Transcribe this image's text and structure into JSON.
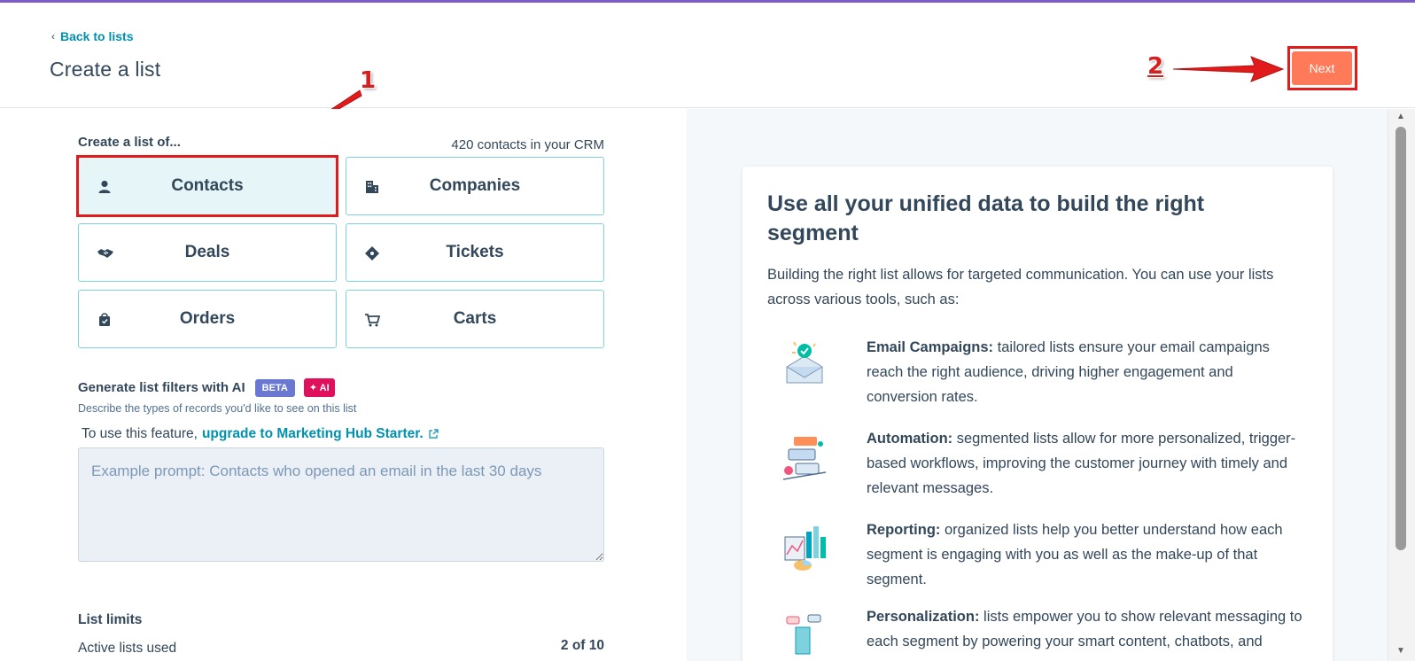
{
  "header": {
    "back_label": "Back to lists",
    "title": "Create a list",
    "next_label": "Next"
  },
  "annotations": {
    "step1": "1",
    "step2": "2",
    "color": "#e11b1b"
  },
  "object_picker": {
    "label": "Create a list of...",
    "crm_count": "420 contacts in your CRM",
    "items": [
      {
        "label": "Contacts",
        "icon": "person-icon",
        "selected": true
      },
      {
        "label": "Companies",
        "icon": "building-icon",
        "selected": false
      },
      {
        "label": "Deals",
        "icon": "handshake-icon",
        "selected": false
      },
      {
        "label": "Tickets",
        "icon": "ticket-icon",
        "selected": false
      },
      {
        "label": "Orders",
        "icon": "shopping-bag-icon",
        "selected": false
      },
      {
        "label": "Carts",
        "icon": "cart-icon",
        "selected": false
      }
    ]
  },
  "ai_filters": {
    "title": "Generate list filters with AI",
    "beta_badge": "BETA",
    "ai_badge": "✦ AI",
    "help": "Describe the types of records you'd like to see on this list",
    "upgrade_prefix": "To use this feature,",
    "upgrade_link": "upgrade to Marketing Hub Starter.",
    "placeholder": "Example prompt: Contacts who opened an email in the last 30 days"
  },
  "list_limits": {
    "title": "List limits",
    "active_label": "Active lists used",
    "active_value": "2 of 10"
  },
  "info_panel": {
    "title": "Use all your unified data to build the right segment",
    "intro": "Building the right list allows for targeted communication. You can use your lists across various tools, such as:",
    "features": [
      {
        "heading": "Email Campaigns:",
        "text": "tailored lists ensure your email campaigns reach the right audience, driving higher engagement and conversion rates.",
        "icon": "email-envelope-illustration"
      },
      {
        "heading": "Automation:",
        "text": "segmented lists allow for more personalized, trigger-based workflows, improving the customer journey with timely and relevant messages.",
        "icon": "automation-illustration"
      },
      {
        "heading": "Reporting:",
        "text": "organized lists help you better understand how each segment is engaging with you as well as the make-up of that segment.",
        "icon": "reporting-chart-illustration"
      },
      {
        "heading": "Personalization:",
        "text": "lists empower you to show relevant messaging to each segment by powering your smart content, chatbots, and",
        "icon": "personalization-illustration"
      }
    ]
  },
  "colors": {
    "accent_teal": "#0091ae",
    "primary_button": "#ff7a59",
    "text": "#33475b",
    "card_border": "#7fd1de",
    "selected_bg": "#e5f5f8",
    "beta_badge": "#6a78d1",
    "ai_badge": "#e0105c"
  }
}
